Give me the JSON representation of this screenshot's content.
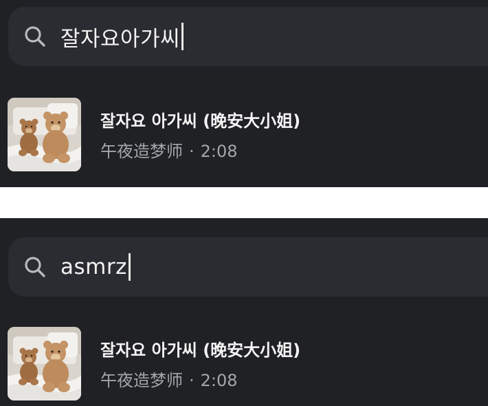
{
  "colors": {
    "panel_background": "#202125",
    "search_background": "#2b2c31",
    "title_text": "#f5f5f5",
    "meta_text": "#a5a6ab",
    "separator": "#ffffff"
  },
  "panels": [
    {
      "search": {
        "icon": "search-icon",
        "query": "잘자요아가씨"
      },
      "result": {
        "artwork": "teddy-bears-on-bed",
        "title": "잘자요 아가씨 (晚安大小姐)",
        "artist": "午夜造梦师",
        "separator": "·",
        "duration": "2:08"
      }
    },
    {
      "search": {
        "icon": "search-icon",
        "query": "asmrz"
      },
      "result": {
        "artwork": "teddy-bears-on-bed",
        "title": "잘자요 아가씨 (晚安大小姐)",
        "artist": "午夜造梦师",
        "separator": "·",
        "duration": "2:08"
      }
    }
  ]
}
